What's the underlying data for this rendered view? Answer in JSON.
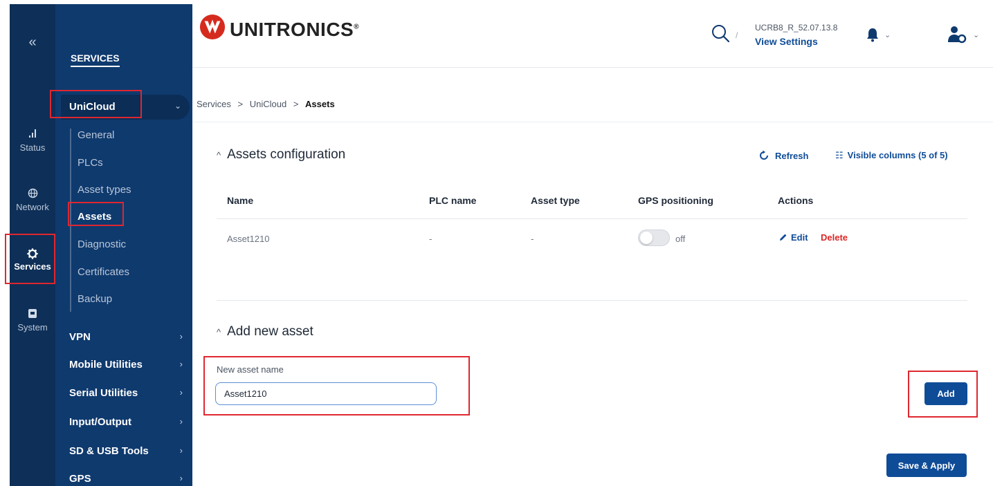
{
  "rail": {
    "collapse_glyph": "«",
    "items": [
      {
        "label": "Status",
        "icon": "signal-bars-icon"
      },
      {
        "label": "Network",
        "icon": "globe-icon"
      },
      {
        "label": "Services",
        "icon": "gear-icon"
      },
      {
        "label": "System",
        "icon": "system-icon"
      }
    ]
  },
  "sidebar": {
    "title": "SERVICES",
    "expanded": {
      "label": "UniCloud"
    },
    "sub_items": [
      {
        "label": "General"
      },
      {
        "label": "PLCs"
      },
      {
        "label": "Asset types"
      },
      {
        "label": "Assets"
      },
      {
        "label": "Diagnostic"
      },
      {
        "label": "Certificates"
      },
      {
        "label": "Backup"
      }
    ],
    "menu": [
      {
        "label": "VPN"
      },
      {
        "label": "Mobile Utilities"
      },
      {
        "label": "Serial Utilities"
      },
      {
        "label": "Input/Output"
      },
      {
        "label": "SD & USB Tools"
      },
      {
        "label": "GPS"
      }
    ],
    "chevron": "›",
    "expanded_chevron": "⌄"
  },
  "header": {
    "brand": "UNITRONICS",
    "registered": "®",
    "search_separator": "/",
    "device_id": "UCRB8_R_52.07.13.8",
    "view_settings": "View Settings",
    "dropdown_glyph": "⌄"
  },
  "breadcrumb": {
    "items": [
      "Services",
      "UniCloud",
      "Assets"
    ],
    "separator": ">"
  },
  "assets_config": {
    "collapse_glyph": "^",
    "title": "Assets configuration",
    "refresh_label": "Refresh",
    "visible_columns_label": "Visible columns (5 of 5)",
    "columns": [
      "Name",
      "PLC name",
      "Asset type",
      "GPS positioning",
      "Actions"
    ],
    "rows": [
      {
        "name": "Asset1210",
        "plc_name": "-",
        "asset_type": "-",
        "gps_state": "off",
        "edit": "Edit",
        "delete": "Delete"
      }
    ]
  },
  "add_asset": {
    "collapse_glyph": "^",
    "title": "Add new asset",
    "field_label": "New asset name",
    "field_value": "Asset1210",
    "add_label": "Add"
  },
  "save_apply_label": "Save & Apply",
  "colors": {
    "rail_bg": "#0e2f57",
    "sidebar_bg": "#0f3a6e",
    "brand_red": "#d52b1e",
    "accent_blue": "#0f4c97",
    "highlight_red": "#e0262f",
    "delete_red": "#dc2626"
  }
}
